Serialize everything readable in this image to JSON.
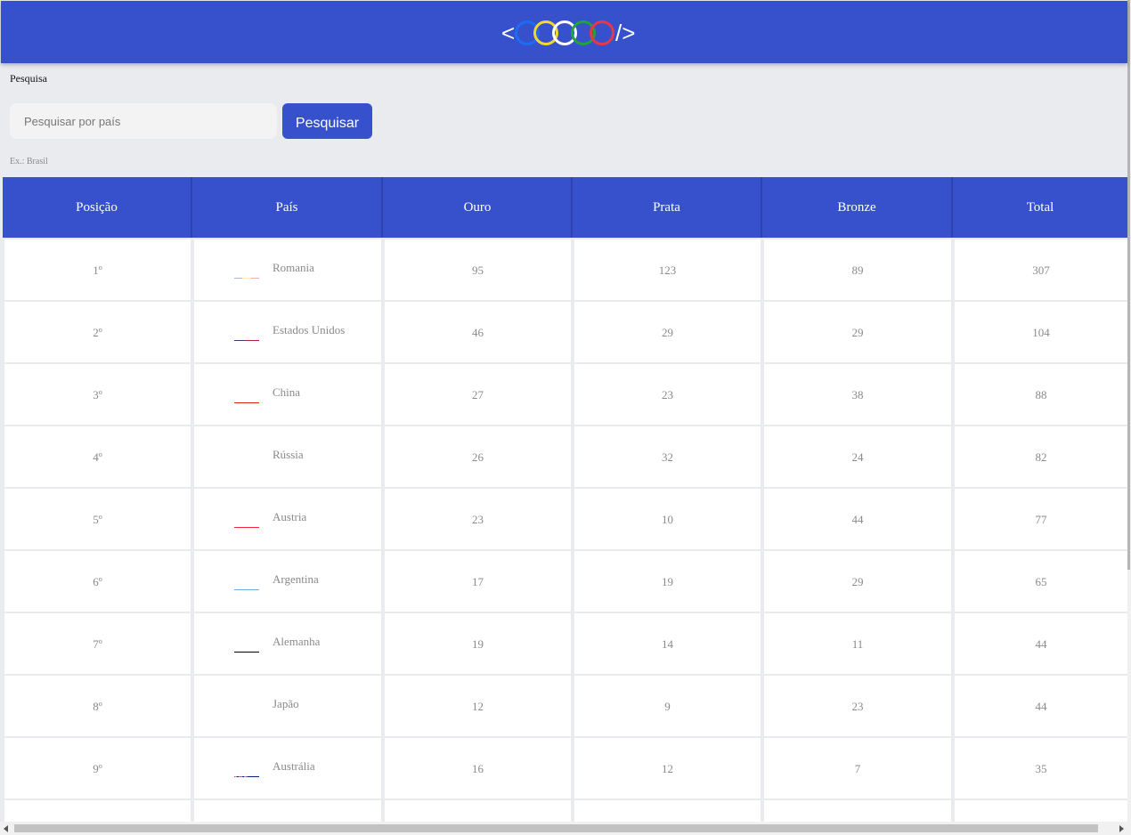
{
  "header": {
    "logo_open": "<",
    "logo_close": "/>",
    "ring_colors": [
      "#1d6cf2",
      "#f4d62c",
      "#ffffff",
      "#22a33a",
      "#e8364a"
    ]
  },
  "search": {
    "title": "Pesquisa",
    "placeholder": "Pesquisar por país",
    "button_label": "Pesquisar",
    "hint": "Ex.: Brasil"
  },
  "colors": {
    "accent": "#3751cc",
    "background": "#e9ebee",
    "cell_text": "#8a8a8a"
  },
  "table": {
    "columns": [
      "Posição",
      "País",
      "Ouro",
      "Prata",
      "Bronze",
      "Total"
    ],
    "rows": [
      {
        "position": "1º",
        "country": "Romania",
        "flag": "romania-flag-icon",
        "gold": "95",
        "silver": "123",
        "bronze": "89",
        "total": "307"
      },
      {
        "position": "2º",
        "country": "Estados Unidos",
        "flag": "usa-flag-icon",
        "gold": "46",
        "silver": "29",
        "bronze": "29",
        "total": "104"
      },
      {
        "position": "3º",
        "country": "China",
        "flag": "china-flag-icon",
        "gold": "27",
        "silver": "23",
        "bronze": "38",
        "total": "88"
      },
      {
        "position": "4º",
        "country": "Rússia",
        "flag": "russia-flag-icon",
        "gold": "26",
        "silver": "32",
        "bronze": "24",
        "total": "82"
      },
      {
        "position": "5º",
        "country": "Austria",
        "flag": "austria-flag-icon",
        "gold": "23",
        "silver": "10",
        "bronze": "44",
        "total": "77"
      },
      {
        "position": "6º",
        "country": "Argentina",
        "flag": "argentina-flag-icon",
        "gold": "17",
        "silver": "19",
        "bronze": "29",
        "total": "65"
      },
      {
        "position": "7º",
        "country": "Alemanha",
        "flag": "germany-flag-icon",
        "gold": "19",
        "silver": "14",
        "bronze": "11",
        "total": "44"
      },
      {
        "position": "8º",
        "country": "Japão",
        "flag": "japan-flag-icon",
        "gold": "12",
        "silver": "9",
        "bronze": "23",
        "total": "44"
      },
      {
        "position": "9º",
        "country": "Austrália",
        "flag": "australia-flag-icon",
        "gold": "16",
        "silver": "12",
        "bronze": "7",
        "total": "35"
      }
    ]
  }
}
